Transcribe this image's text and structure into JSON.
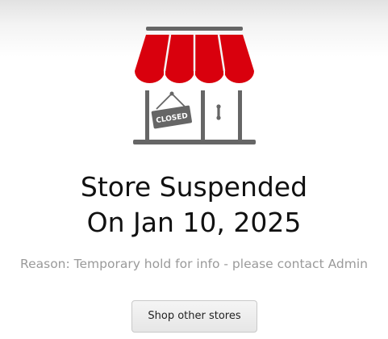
{
  "store": {
    "sign_text": "CLOSED",
    "awning_color": "#d9000d",
    "title_line1": "Store Suspended",
    "title_line2": "On Jan 10, 2025",
    "reason": "Reason: Temporary hold for info - please contact Admin"
  },
  "actions": {
    "shop_other_label": "Shop other stores"
  }
}
